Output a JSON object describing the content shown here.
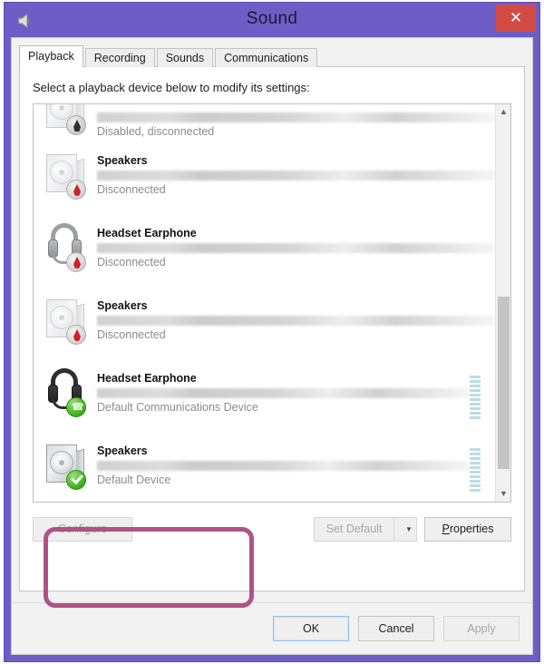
{
  "window": {
    "title": "Sound",
    "icon": "speaker-icon",
    "close_label": "✕",
    "accent_color": "#6e5dc6",
    "close_color": "#d24b44"
  },
  "tabs": [
    {
      "label": "Playback",
      "active": true
    },
    {
      "label": "Recording",
      "active": false
    },
    {
      "label": "Sounds",
      "active": false
    },
    {
      "label": "Communications",
      "active": false
    }
  ],
  "instruction": "Select a playback device below to modify its settings:",
  "devices": [
    {
      "name": "",
      "subtitle_redacted": true,
      "status": "Disabled, disconnected",
      "icon": "speaker-icon",
      "badge": "disabled-badge",
      "partial": true,
      "meter": false,
      "selected": false
    },
    {
      "name": "Speakers",
      "subtitle_redacted": true,
      "status": "Disconnected",
      "icon": "speaker-icon",
      "badge": "disconnected-badge",
      "partial": false,
      "meter": false,
      "selected": false
    },
    {
      "name": "Headset Earphone",
      "subtitle_redacted": true,
      "status": "Disconnected",
      "icon": "headset-icon",
      "badge": "disconnected-badge",
      "partial": false,
      "meter": false,
      "selected": false
    },
    {
      "name": "Speakers",
      "subtitle_redacted": true,
      "status": "Disconnected",
      "icon": "speaker-icon",
      "badge": "disconnected-badge",
      "partial": false,
      "meter": false,
      "selected": false
    },
    {
      "name": "Headset Earphone",
      "subtitle_redacted": true,
      "status": "Default Communications Device",
      "icon": "headset-icon",
      "badge": "default-communications-badge",
      "partial": false,
      "meter": true,
      "selected": false
    },
    {
      "name": "Speakers",
      "subtitle_redacted": true,
      "status": "Default Device",
      "icon": "speaker-icon",
      "badge": "default-device-badge",
      "partial": false,
      "meter": true,
      "selected": true
    }
  ],
  "highlight": {
    "color": "#b05285",
    "target": "Speakers - Default Device"
  },
  "scrollbar": {
    "up_glyph": "▲",
    "down_glyph": "▼"
  },
  "actions": {
    "configure": "Configure",
    "configure_disabled": true,
    "set_default": "Set Default",
    "set_default_disabled": true,
    "set_default_arrow": "▼",
    "properties_prefix": "P",
    "properties_rest": "roperties"
  },
  "footer": {
    "ok": "OK",
    "cancel": "Cancel",
    "apply": "Apply",
    "apply_disabled": true
  }
}
